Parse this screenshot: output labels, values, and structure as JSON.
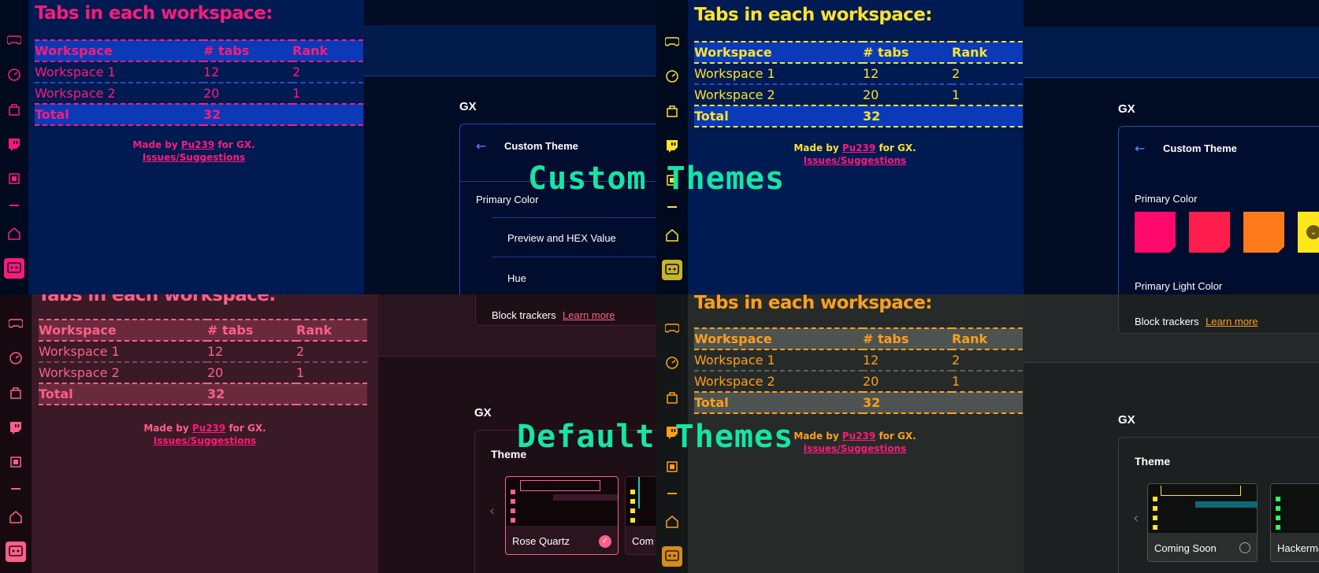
{
  "tabs_widget": {
    "title": "Tabs in each workspace:",
    "headers": [
      "Workspace",
      "# tabs",
      "Rank"
    ],
    "rows": [
      {
        "name": "Workspace 1",
        "tabs": "12",
        "rank": "2"
      },
      {
        "name": "Workspace 2",
        "tabs": "20",
        "rank": "1"
      }
    ],
    "total_label": "Total",
    "total_value": "32",
    "made_by_prefix": "Made by",
    "author": "Pu239",
    "made_by_suffix": "for GX.",
    "issues_link": "Issues/Suggestions"
  },
  "overlays": {
    "custom": "Custom Themes",
    "default": "Default Themes"
  },
  "settings": {
    "section": "GX",
    "custom_theme": "Custom Theme",
    "primary_color": "Primary Color",
    "primary_light_color": "Primary Light Color",
    "preview_hex": "Preview and HEX Value",
    "hue": "Hue",
    "block_trackers": "Block trackers",
    "learn_more": "Learn more",
    "theme": "Theme",
    "themes": {
      "rose": "Rose Quartz",
      "coming_soon": "Coming Soon",
      "com_partial": "Com",
      "hacker_partial": "Hackerma"
    }
  },
  "colors": {
    "q1_accent": "#ff1a7a",
    "q1_table_bg": "#0a3ab8",
    "q2_accent": "#fde32c",
    "q3_accent": "#ff5f8a",
    "q3_table_bg": "#6a2a3d",
    "q4_accent": "#ff9f1c",
    "q4_table_bg": "#4d5350",
    "overlay": "#16e5a4",
    "swatches": [
      "#ff0a6c",
      "#ff1d4e",
      "#ff7a1a",
      "#ffe81a"
    ]
  },
  "icons": [
    "gamepad-icon",
    "speedometer-icon",
    "shopping-bag-icon",
    "twitch-icon",
    "cpu-icon",
    "home-icon",
    "gx-corner-icon"
  ]
}
